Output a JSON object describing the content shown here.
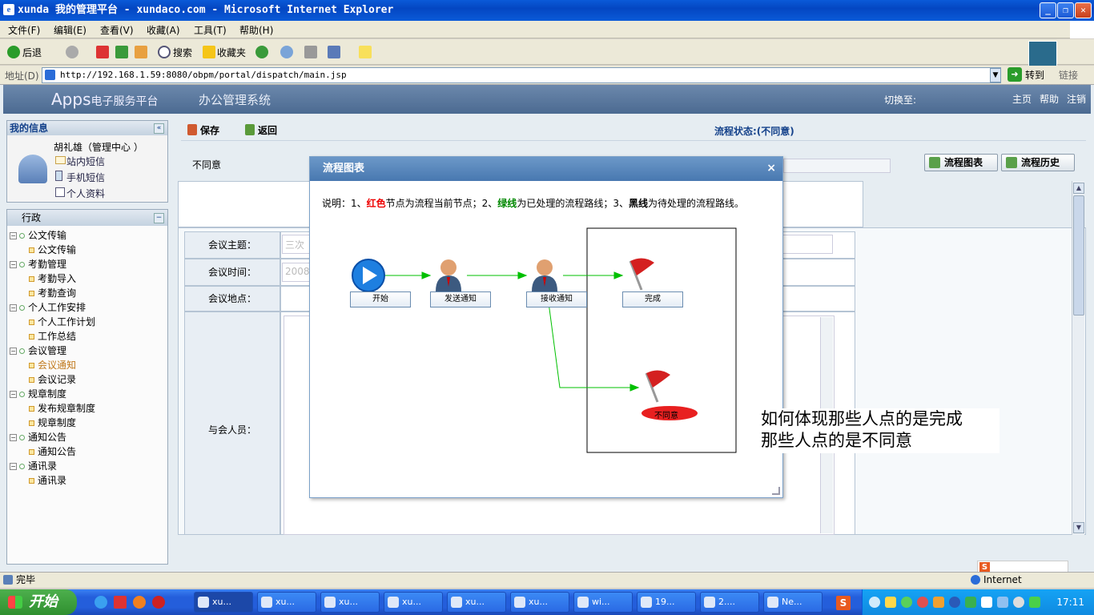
{
  "window": {
    "title": "xunda 我的管理平台 - xundaco.com - Microsoft Internet Explorer"
  },
  "menu": [
    "文件(F)",
    "编辑(E)",
    "查看(V)",
    "收藏(A)",
    "工具(T)",
    "帮助(H)"
  ],
  "toolbar": {
    "back": "后退",
    "search": "搜索",
    "favorites": "收藏夹"
  },
  "address": {
    "label": "地址(D)",
    "url": "http://192.168.1.59:8080/obpm/portal/dispatch/main.jsp",
    "go": "转到",
    "links": "链接"
  },
  "app": {
    "logo": "Apps",
    "logo_sub": "电子服务平台",
    "system": "办公管理系统",
    "switch": "切换至:",
    "home": "主页",
    "help": "帮助",
    "logout": "注销"
  },
  "myinfo": {
    "title": "我的信息",
    "user": "胡礼雄（管理中心 ）",
    "sms": "站内短信",
    "mobile": "手机短信",
    "profile": "个人资料"
  },
  "nav": {
    "title": "行政",
    "groups": [
      {
        "label": "公文传输",
        "items": [
          "公文传输"
        ]
      },
      {
        "label": "考勤管理",
        "items": [
          "考勤导入",
          "考勤查询"
        ]
      },
      {
        "label": "个人工作安排",
        "items": [
          "个人工作计划",
          "工作总结"
        ]
      },
      {
        "label": "会议管理",
        "items": [
          "会议通知",
          "会议记录"
        ]
      },
      {
        "label": "规章制度",
        "items": [
          "发布规章制度",
          "规章制度"
        ]
      },
      {
        "label": "通知公告",
        "items": [
          "通知公告"
        ]
      },
      {
        "label": "通讯录",
        "items": [
          "通讯录"
        ]
      }
    ]
  },
  "main": {
    "save": "保存",
    "back": "返回",
    "status": "流程状态:(不同意)",
    "decision": "不同意",
    "flowchart_btn": "流程图表",
    "flowhistory_btn": "流程历史",
    "fields": {
      "subject": "会议主题：",
      "time": "会议时间：",
      "place": "会议地点：",
      "attendees": "与会人员："
    },
    "subject_value": "三次",
    "time_value": "2008"
  },
  "dialog": {
    "title": "流程图表",
    "close": "×",
    "note_1": "说明：1、",
    "note_red": "红色",
    "note_2": "节点为流程当前节点；2、",
    "note_green": "绿线",
    "note_3": "为已处理的流程路线；3、",
    "note_black": "黑线",
    "note_4": "为待处理的流程路线。",
    "nodes": {
      "start": "开始",
      "send": "发送通知",
      "receive": "接收通知",
      "done": "完成",
      "reject": "不同意"
    }
  },
  "annotation": {
    "line1": "如何体现那些人点的是完成",
    "line2": "那些人点的是不同意"
  },
  "statusbar": {
    "text": "完毕",
    "zone": "Internet"
  },
  "taskbar": {
    "start": "开始",
    "tasks": [
      "xu...",
      "xu...",
      "xu...",
      "xu...",
      "xu...",
      "xu...",
      "wi...",
      "19...",
      "2....",
      "Ne..."
    ],
    "clock": "17:11"
  },
  "colors": {
    "red": "#e00000",
    "green": "#00aa00",
    "header": "#4b6a91"
  }
}
